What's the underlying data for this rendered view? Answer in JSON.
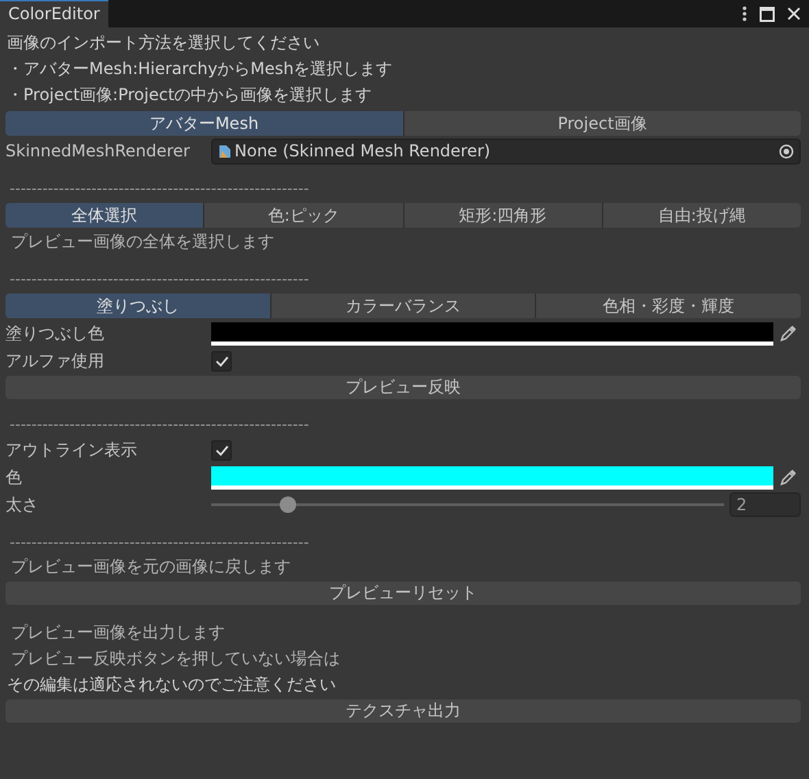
{
  "window": {
    "title": "ColorEditor"
  },
  "rows": [
    {
      "kind": "text",
      "text": "画像のインポート方法を選択してください",
      "indent": false
    },
    {
      "kind": "text",
      "text": "・アバターMesh:HierarchyからMeshを選択します",
      "indent": false
    },
    {
      "kind": "text",
      "text": "・Project画像:Projectの中から画像を選択します",
      "indent": false
    },
    {
      "kind": "tabs",
      "tabs": [
        {
          "label": "アバターMesh",
          "selected": true
        },
        {
          "label": "Project画像",
          "selected": false
        }
      ]
    },
    {
      "kind": "object",
      "label": "SkinnedMeshRenderer",
      "value": "None (Skinned Mesh Renderer)"
    },
    {
      "kind": "spacer"
    },
    {
      "kind": "separator",
      "text": "-------------------------------------------------------"
    },
    {
      "kind": "tabs",
      "tabs": [
        {
          "label": "全体選択",
          "selected": true
        },
        {
          "label": "色:ピック",
          "selected": false
        },
        {
          "label": "矩形:四角形",
          "selected": false
        },
        {
          "label": "自由:投げ縄",
          "selected": false
        }
      ]
    },
    {
      "kind": "text",
      "text": "プレビュー画像の全体を選択します",
      "indent": true
    },
    {
      "kind": "spacer"
    },
    {
      "kind": "separator",
      "text": "-------------------------------------------------------"
    },
    {
      "kind": "tabs",
      "tabs": [
        {
          "label": "塗りつぶし",
          "selected": true
        },
        {
          "label": "カラーバランス",
          "selected": false
        },
        {
          "label": "色相・彩度・輝度",
          "selected": false
        }
      ]
    },
    {
      "kind": "color",
      "label": "塗りつぶし色",
      "color": "#000000"
    },
    {
      "kind": "toggle",
      "label": "アルファ使用",
      "checked": true
    },
    {
      "kind": "button",
      "label": "プレビュー反映"
    },
    {
      "kind": "spacer"
    },
    {
      "kind": "separator",
      "text": "-------------------------------------------------------"
    },
    {
      "kind": "toggle",
      "label": "アウトライン表示",
      "checked": true
    },
    {
      "kind": "color",
      "label": "色",
      "color": "#00ffff"
    },
    {
      "kind": "slider",
      "label": "太さ",
      "level": 0.15,
      "value": "2"
    },
    {
      "kind": "spacer"
    },
    {
      "kind": "separator",
      "text": "-------------------------------------------------------"
    },
    {
      "kind": "text",
      "text": "プレビュー画像を元の画像に戻します",
      "indent": true
    },
    {
      "kind": "button",
      "label": "プレビューリセット"
    },
    {
      "kind": "spacer"
    },
    {
      "kind": "text",
      "text": "プレビュー画像を出力します",
      "indent": true
    },
    {
      "kind": "text",
      "text": "プレビュー反映ボタンを押していない場合は",
      "indent": true
    },
    {
      "kind": "text",
      "text": "その編集は適応されないのでご注意ください",
      "indent": false
    },
    {
      "kind": "button",
      "label": "テクスチャ出力"
    }
  ]
}
